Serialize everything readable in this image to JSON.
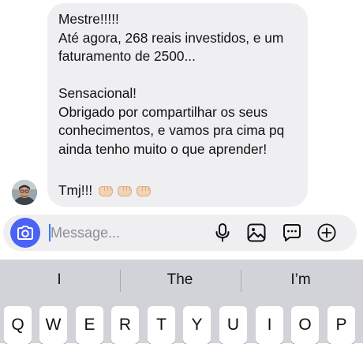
{
  "message": {
    "lines": [
      "Mestre!!!!!",
      "Até agora, 268 reais investidos, e um",
      "faturamento de 2500...",
      "",
      "Sensacional!",
      "Obrigado por compartilhar os seus",
      "conhecimentos, e vamos pra cima pq",
      "ainda tenho muito o que aprender!"
    ],
    "closing": "Tmj!!!",
    "closing_emojis": [
      "oncoming-fist-light-skin",
      "oncoming-fist-light-skin",
      "oncoming-fist-light-skin"
    ]
  },
  "composer": {
    "placeholder": "Message...",
    "value": "",
    "icons": [
      "camera-icon",
      "microphone-icon",
      "gallery-icon",
      "sticker-chat-icon",
      "add-plus-icon"
    ],
    "accent": "#4a62f5"
  },
  "keyboard": {
    "suggestions": [
      "I",
      "The",
      "I’m"
    ],
    "keys": [
      "Q",
      "W",
      "E",
      "R",
      "T",
      "Y",
      "U",
      "I",
      "O",
      "P"
    ]
  }
}
